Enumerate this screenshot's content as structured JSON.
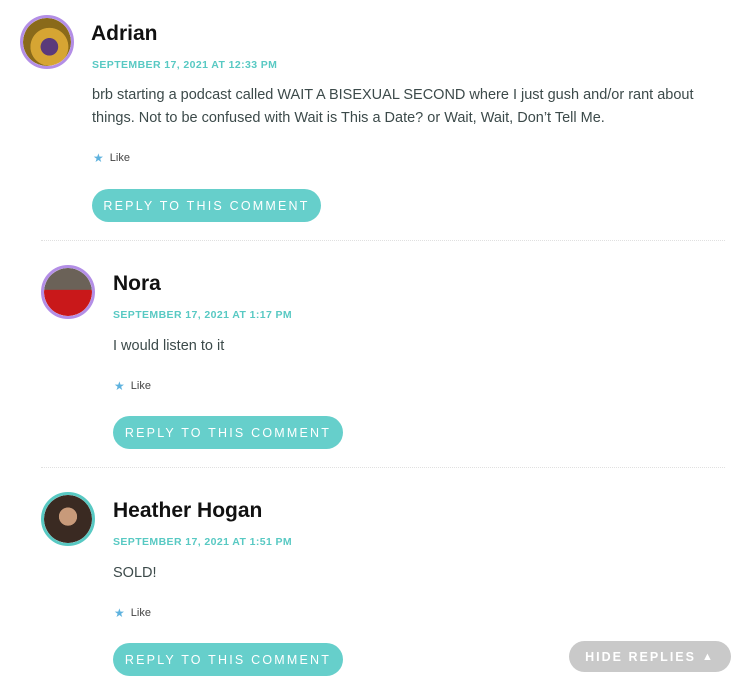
{
  "comments": [
    {
      "author": "Adrian",
      "date": "SEPTEMBER 17, 2021 AT 12:33 PM",
      "text": "brb starting a podcast called WAIT A BISEXUAL SECOND where I just gush and/or rant about things. Not to be confused with Wait is This a Date? or Wait, Wait, Don’t Tell Me.",
      "like_label": "Like",
      "reply_label": "REPLY TO THIS COMMENT"
    },
    {
      "author": "Nora",
      "date": "SEPTEMBER 17, 2021 AT 1:17 PM",
      "text": "I would listen to it",
      "like_label": "Like",
      "reply_label": "REPLY TO THIS COMMENT"
    },
    {
      "author": "Heather Hogan",
      "date": "SEPTEMBER 17, 2021 AT 1:51 PM",
      "text": "SOLD!",
      "like_label": "Like",
      "reply_label": "REPLY TO THIS COMMENT"
    }
  ],
  "hide_replies_label": "HIDE REPLIES",
  "icons": {
    "like": "star-icon",
    "hide": "triangle-up-icon"
  },
  "colors": {
    "accent": "#66cfcb",
    "date": "#58c9c3",
    "avatar_border_purple": "#b38ee6",
    "avatar_border_teal": "#58c9c3",
    "like_star": "#5eb2de",
    "hide_button": "#c9c9c9"
  }
}
